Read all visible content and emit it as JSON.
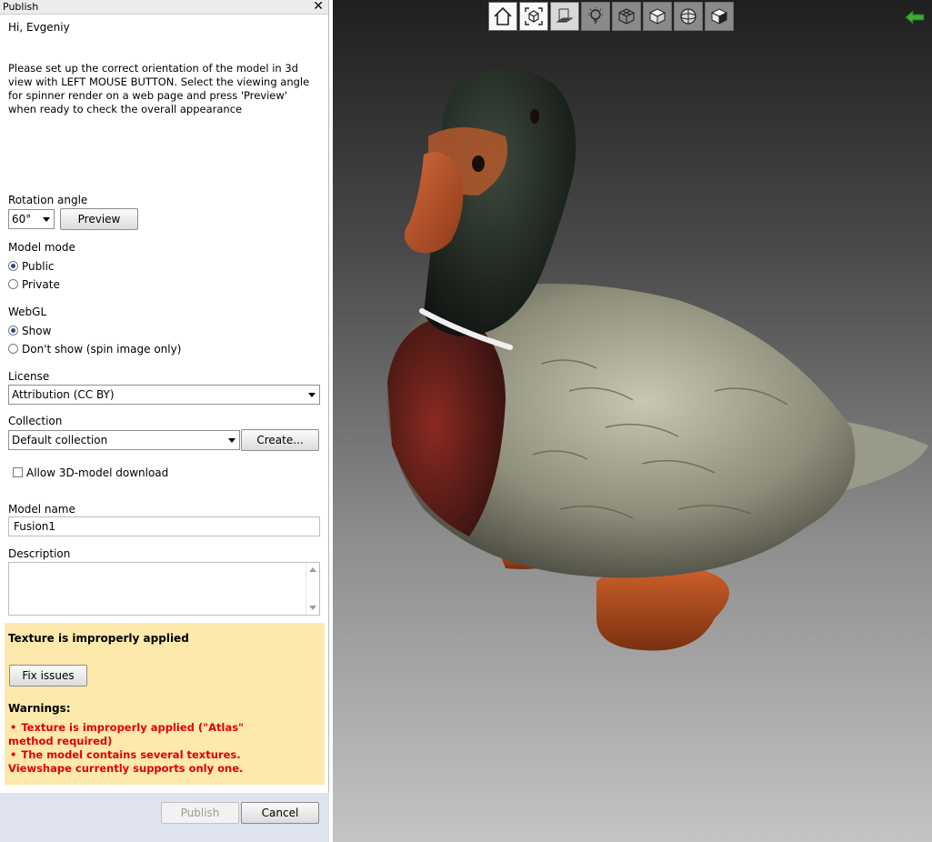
{
  "window": {
    "title": "Publish",
    "close_glyph": "✕"
  },
  "greeting": "Hi, Evgeniy",
  "intro": "Please set up the correct orientation of the model in 3d view with LEFT MOUSE BUTTON. Select the viewing angle for spinner render on a web page and press 'Preview' when ready to check the overall appearance",
  "rotation": {
    "label": "Rotation angle",
    "value": "60°",
    "preview_label": "Preview"
  },
  "model_mode": {
    "label": "Model mode",
    "options": [
      "Public",
      "Private"
    ],
    "selected": "Public"
  },
  "webgl": {
    "label": "WebGL",
    "options": [
      "Show",
      "Don't show (spin image only)"
    ],
    "selected": "Show"
  },
  "license": {
    "label": "License",
    "value": "Attribution (CC BY)"
  },
  "collection": {
    "label": "Collection",
    "value": "Default collection",
    "create_label": "Create..."
  },
  "allow_download": {
    "label": "Allow 3D-model download",
    "checked": false
  },
  "model_name": {
    "label": "Model name",
    "value": "Fusion1"
  },
  "description": {
    "label": "Description",
    "value": ""
  },
  "issues": {
    "header": "Texture is improperly applied",
    "fix_label": "Fix issues",
    "warnings_label": "Warnings:",
    "warnings": [
      "Texture is improperly applied (\"Atlas\" method required)",
      "The model contains several textures. Viewshape currently supports only one."
    ],
    "bullet": "•"
  },
  "footer": {
    "publish_label": "Publish",
    "cancel_label": "Cancel"
  },
  "toolbar_icons": [
    "home-icon",
    "fit-view-icon",
    "grid-icon",
    "light-icon",
    "wireframe-cube-icon",
    "solid-cube-icon",
    "sphere-icon",
    "textured-cube-icon"
  ],
  "colors": {
    "warning_bg": "#fce9ab",
    "warning_text": "#e00000",
    "footer_bg": "#dfe3ef",
    "back_arrow": "#3caa3c"
  }
}
